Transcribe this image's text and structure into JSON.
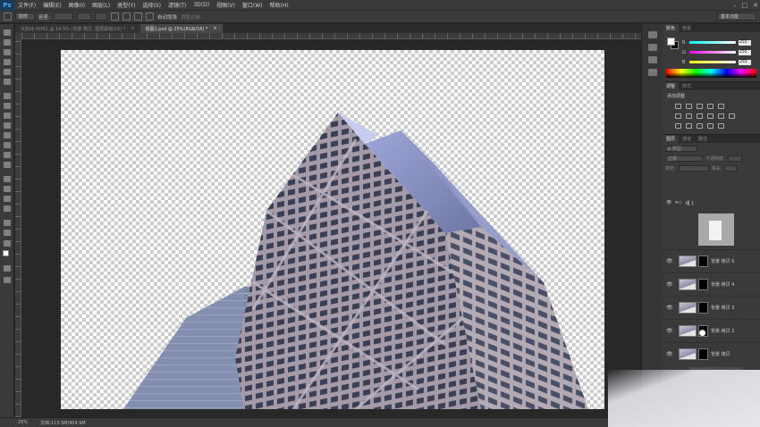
{
  "app": {
    "logo": "Ps"
  },
  "menu": [
    "文件(F)",
    "编辑(E)",
    "图像(I)",
    "图层(L)",
    "类型(Y)",
    "选择(S)",
    "滤镜(T)",
    "3D(D)",
    "视图(V)",
    "窗口(W)",
    "帮助(H)"
  ],
  "window_controls": {
    "minimize": "–",
    "maximize": "□",
    "close": "✕"
  },
  "options": {
    "sample_size": "取样",
    "tolerance_label": "容差:",
    "tolerance_value": "",
    "checkbox_1": "",
    "auto_enhance": "自动增强",
    "refine_edge": "调整边缘...",
    "workspace": "基本功能"
  },
  "tabs": [
    {
      "label": "天际线 HDR1 @ 14.5% (背景 拷贝, 图层蒙版/16) *",
      "close": "×"
    },
    {
      "label": "视图1.psd @ 25%(RGB/16) *",
      "close": "×"
    }
  ],
  "color_panel": {
    "tabs": [
      "颜色",
      "色板"
    ],
    "channels": [
      {
        "label": "R",
        "value": "255"
      },
      {
        "label": "G",
        "value": "255"
      },
      {
        "label": "B",
        "value": "255"
      }
    ]
  },
  "adjust_panel": {
    "tabs": [
      "调整",
      "样式"
    ],
    "title": "添加调整"
  },
  "layers_panel": {
    "tabs": [
      "图层",
      "通道",
      "路径"
    ],
    "filter": "ρ 类型",
    "blend_mode": "正常",
    "opacity_label": "不透明度:",
    "lock_label": "锁定:",
    "fill_label": "填充:",
    "group": "组 1",
    "layers": [
      {
        "name": "背景 拷贝 5"
      },
      {
        "name": "背景 拷贝 4"
      },
      {
        "name": "背景 拷贝 3"
      },
      {
        "name": "背景 拷贝 2"
      },
      {
        "name": "背景 拷贝"
      }
    ]
  },
  "status": {
    "zoom": "25%",
    "doc": "文档:113.5M/904.9M"
  },
  "colors": {
    "accent": "#1a3b5a",
    "panel_bg": "#3a3a3a",
    "canvas_bg": "#282828"
  }
}
